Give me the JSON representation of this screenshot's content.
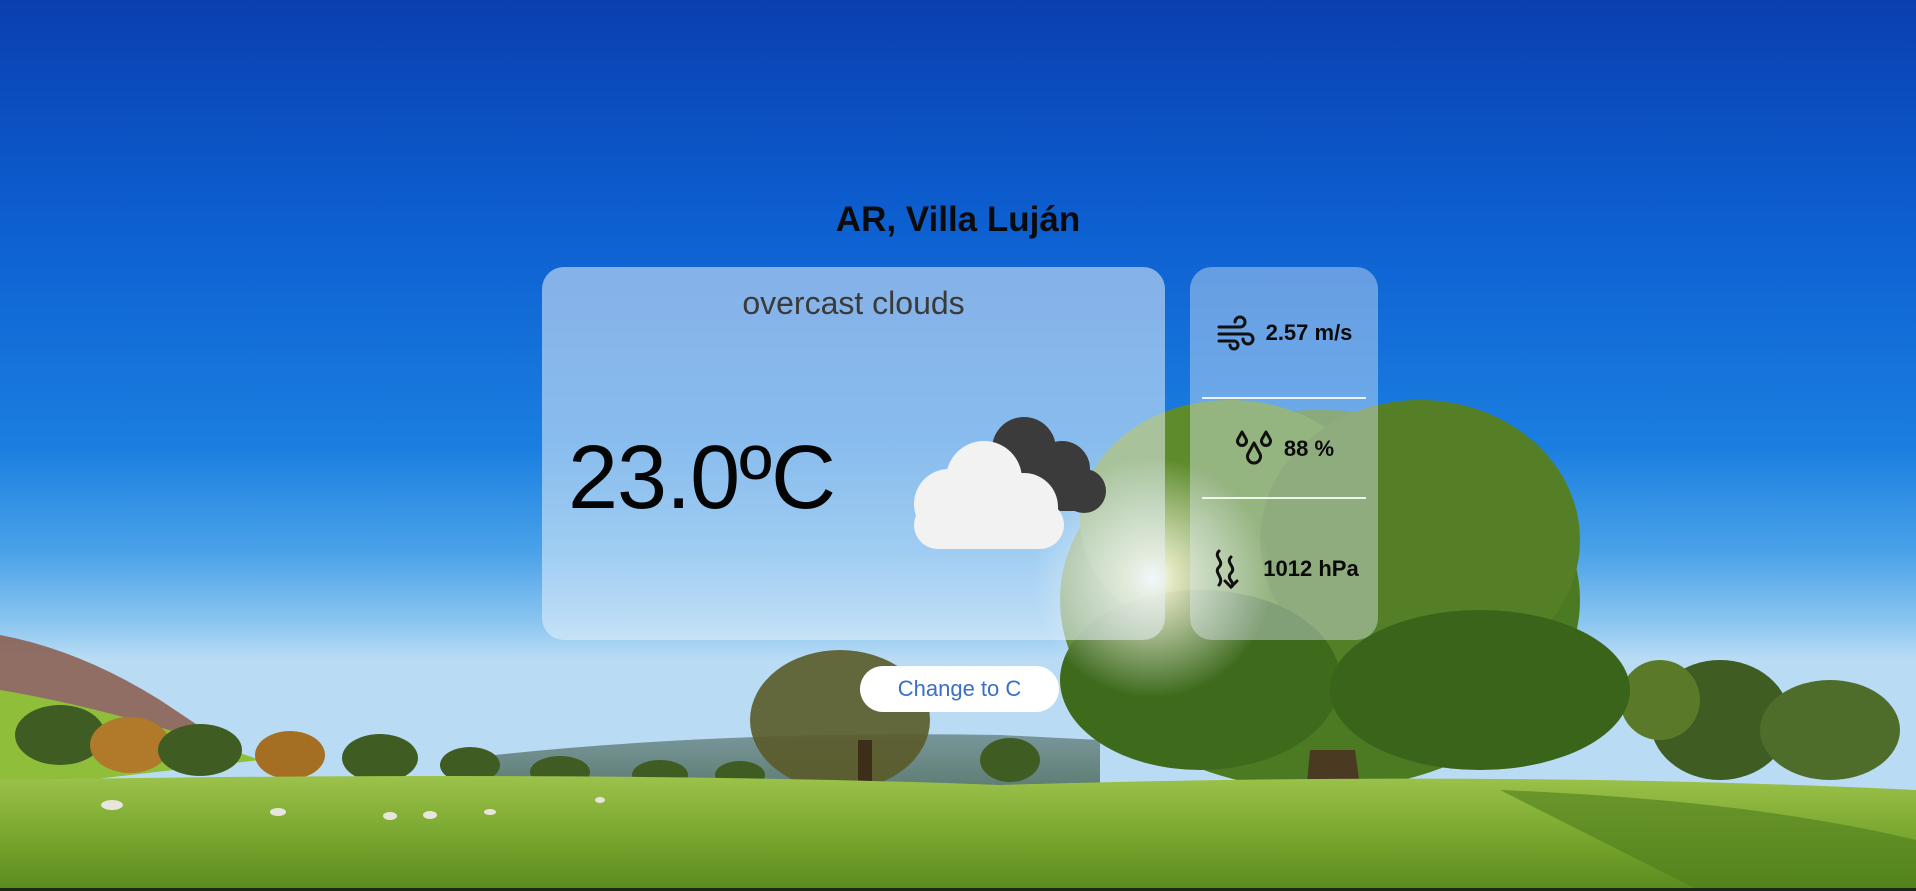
{
  "location": {
    "title": "AR, Villa Luján"
  },
  "current": {
    "condition": "overcast clouds",
    "temperature": "23.0ºC",
    "icon": "overcast-clouds-icon"
  },
  "stats": {
    "wind": {
      "icon": "wind-icon",
      "value": "2.57 m/s"
    },
    "humidity": {
      "icon": "humidity-icon",
      "value": "88 %"
    },
    "pressure": {
      "icon": "pressure-icon",
      "value": "1012 hPa"
    }
  },
  "controls": {
    "change_unit_label": "Change to C"
  },
  "colors": {
    "button_text": "#3a6fc4",
    "card_bg": "rgba(230,240,250,0.55)"
  }
}
